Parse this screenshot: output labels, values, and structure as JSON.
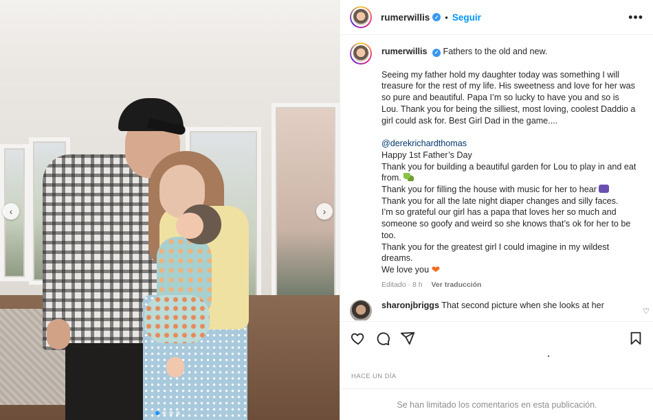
{
  "post": {
    "username": "rumerwillis",
    "follow_label": "Seguir",
    "separator": "•",
    "more_label": "•••"
  },
  "photo": {
    "carousel_index": 1,
    "carousel_total": 4
  },
  "caption": {
    "username": "rumerwillis",
    "first_line": "Fathers to the old and new.",
    "paragraph1": "Seeing my father hold my daughter today was something I will treasure for the rest of my life. His sweetness and love for her was so pure and beautiful. Papa I’m so lucky to have you and so is Lou. Thank you for being the silliest, most loving, coolest Daddio a girl could ask for. Best Girl Dad in the game....",
    "mention": "@derekrichardthomas",
    "line_fathers_day": "Happy 1st Father’s Day",
    "line_garden": "Thank you for building a beautiful garden for Lou to play in and eat from.",
    "line_music": "Thank you for filling the house with music for her to hear",
    "line_diaper": "Thank you for all the late night diaper changes and silly faces.",
    "line_grateful": "I’m so grateful our girl has a papa that loves her so much and someone so goofy and weird so she knows that’s ok for her to be too.",
    "line_greatest": "Thank you for the greatest girl I could imagine in my wildest dreams.",
    "line_love": "We love you",
    "edited": "Editado · 8 h",
    "see_translation": "Ver traducción"
  },
  "comment": {
    "username": "sharonjbriggs",
    "text": "That second picture when she looks at her"
  },
  "footer": {
    "time": "HACE UN DÍA",
    "comments_limited": "Se han limitado los comentarios en esta publicación."
  },
  "icons": {
    "heart": "heart-icon",
    "comment": "comment-icon",
    "share": "share-icon",
    "save": "bookmark-icon"
  },
  "colors": {
    "link_blue": "#0095f6",
    "mention_blue": "#00376b",
    "muted": "#8e8e8e",
    "text": "#262626"
  }
}
